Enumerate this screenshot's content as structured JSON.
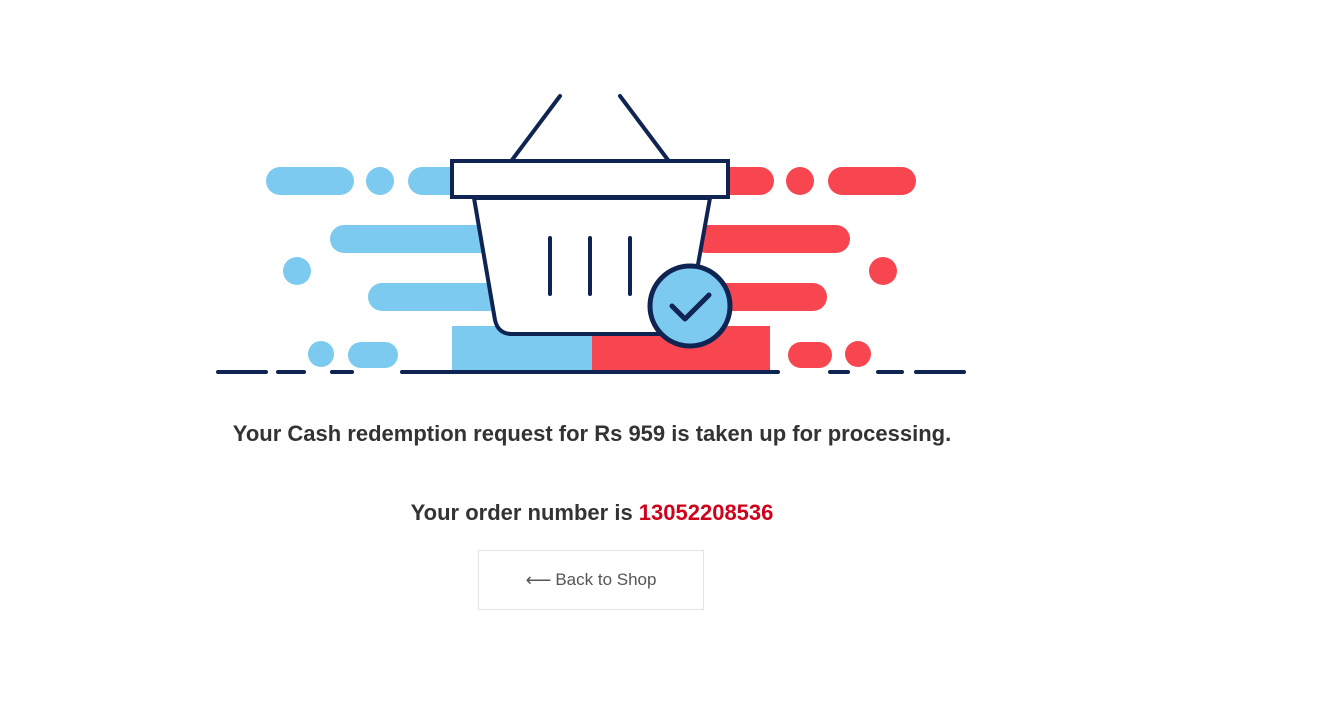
{
  "confirmation": {
    "message": "Your Cash redemption request for Rs 959 is taken up for processing.",
    "order_prefix": "Your order number is ",
    "order_number": "13052208536"
  },
  "actions": {
    "back_icon": "⟵",
    "back_label": "Back to Shop"
  },
  "illustration": {
    "icons": [
      "shopping-basket-icon",
      "checkmark-circle-icon"
    ],
    "colors": {
      "blue": "#7ccaf0",
      "red": "#f7464f",
      "navy": "#0f2453"
    }
  }
}
